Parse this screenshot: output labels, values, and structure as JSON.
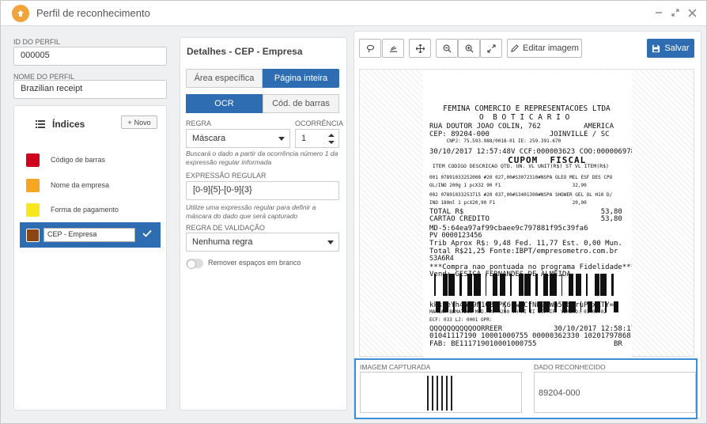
{
  "window": {
    "title": "Perfil de reconhecimento"
  },
  "profile": {
    "id_label": "ID DO PERFIL",
    "id_value": "000005",
    "name_label": "NOME DO PERFIL",
    "name_value": "Brazilian receipt"
  },
  "indices": {
    "title": "Índices",
    "new_label": "Novo",
    "items": [
      {
        "label": "Código de barras",
        "color": "#d0021b"
      },
      {
        "label": "Nome da empresa",
        "color": "#f5a623"
      },
      {
        "label": "Forma de pagamento",
        "color": "#f8e71c"
      },
      {
        "label": "CEP - Empresa",
        "color": "#8b4513"
      }
    ]
  },
  "details": {
    "title": "Detalhes - CEP - Empresa",
    "area_tabs": [
      "Área específica",
      "Página inteira"
    ],
    "mode_tabs": [
      "OCR",
      "Cód. de barras"
    ],
    "rule_label": "REGRA",
    "rule_value": "Máscara",
    "occurrence_label": "OCORRÊNCIA",
    "occurrence_value": "1",
    "rule_help": "Buscará o dado a partir da ocorrência número 1 da expressão regular informada",
    "regex_label": "EXPRESSÃO REGULAR",
    "regex_value": "[0-9]{5}-[0-9]{3}",
    "regex_help": "Utilize uma expressão regular para definir a máscara do dado que será capturado",
    "validation_label": "REGRA DE VALIDAÇÃO",
    "validation_value": "Nenhuma regra",
    "remove_spaces_label": "Remover espaços em branco"
  },
  "toolbar": {
    "edit_image": "Editar imagem",
    "save": "Salvar"
  },
  "receipt_lines": [
    "   FEMINA COMERCIO E REPRESENTACOES LTDA",
    "           O  B O T I C A R I O",
    "RUA DOUTOR JOAO COLIN, 762          AMERICA",
    "CEP: 89204-000              JOINVILLE / SC",
    "      CNPJ: 75.593.988/0018-01 IE: 259.391.670",
    "30/10/2017 12:57:48V CCF:000003623 COO:000006978",
    "             CUPOM  FISCAL",
    " ITEM CODIGO DESCRICAO QTD. UN. VL UNIT(R$) ST VL ITEM(R$)",
    "001 07891033252008 #20 027,00#S3072310#NSPA OLEO MEL ESF DES CPO",
    "OL/INO 200g 1 pcX32 90 F1                         32,90",
    "002 07891033253715 #20 037,00#S3401390#NSPA SHOWER GEL OL H10 D/",
    "INO 180ml 1 pcX20,90 F1                           20,90",
    "TOTAL R$                                53,80",
    "CARTAO CREDITO                          53,80",
    "MD-5:64ea97af99cbaee9c797881f95c39fa6",
    "PV 0000123456",
    "Trib Aprox R$: 9,48 Fed. 11,77 Est. 0,00 Mun.",
    "Total R$21,25 Fonte:IBPT/empresometro.com.br",
    "S3A6R4",
    "***Compra nao pontuada no programa Fidelidade***",
    "Vend: GESICA FERNANDES DE ALMEIDA",
    "kksveYh4A79N1G3rPK6uwJCfNN9dWm52bIruPExKTY=",
    "MARCA: BEMATECH MOD. MP-4200 TH FI II ECF-IF  VERSAO: 01.00.02",
    "ECF: 033 LJ: 0001 OPR:",
    "QQQQQQQQQQOORREER            30/10/2017 12:58:17V",
    "01041117190 10001000755 00000362330 10201797868",
    "FAB: BE111719010001000755                  BR"
  ],
  "capture": {
    "captured_label": "IMAGEM CAPTURADA",
    "recognized_label": "DADO RECONHECIDO",
    "recognized_value": "89204-000"
  }
}
